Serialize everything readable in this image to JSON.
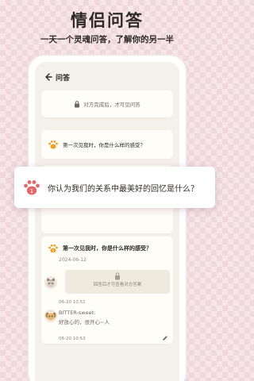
{
  "promo": {
    "title": "情侣问答",
    "subtitle": "一天一个灵魂问答，了解你的另一半"
  },
  "nav": {
    "back_icon": "arrow-left-icon",
    "title": "问答"
  },
  "lock_card": {
    "icon": "lock-icon",
    "text": "对方完成后，才可见问答"
  },
  "question_card": {
    "icon": "paw-icon",
    "text": "第一次见我时，你是什么样的感受？"
  },
  "popup": {
    "icon": "paw-icon",
    "badge": "1",
    "text": "你认为我们的关系中最美好的回忆是什么？"
  },
  "detail": {
    "badge": "1",
    "question": "第一次见我时，你是什么样的感受？",
    "date": "2024-06-12",
    "locked_answer_text": "回答后才可查看对方答案",
    "time_1": "06-20 10:51",
    "answer_name": "BITTER-sweet:",
    "answer_body": "好放心的，很开心~人",
    "time_2": "06-20 10:53",
    "edit_icon": "pencil-icon"
  },
  "colors": {
    "background": "#f6e6ea",
    "screen": "#f4f1ea",
    "paw_orange": "#e8a12a",
    "paw_pink": "#e06a6a"
  }
}
